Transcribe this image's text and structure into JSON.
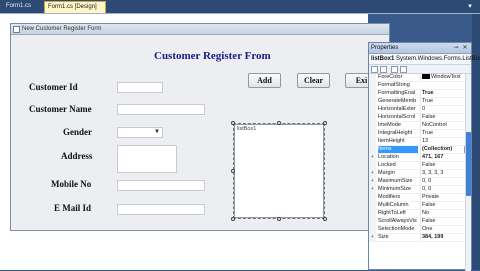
{
  "tabs": [
    {
      "label": "Form1.cs"
    },
    {
      "label": "Form1.cs [Design]"
    }
  ],
  "form": {
    "title": "New Customer Register Form",
    "heading": "Customer Register From",
    "labels": {
      "customer_id": "Customer Id",
      "customer_name": "Customer Name",
      "gender": "Gender",
      "address": "Address",
      "mobile_no": "Mobile No",
      "email_id": "E Mail Id"
    },
    "buttons": {
      "add": "Add",
      "clear": "Clear",
      "exit": "Exi"
    },
    "listbox_label": "listBox1"
  },
  "properties": {
    "title": "Properties",
    "object_name": "listBox1",
    "object_type": "System.Windows.Forms.ListBox",
    "rows": [
      {
        "gutter": "",
        "name": "ForeColor",
        "value": "WindowText",
        "swatch": true
      },
      {
        "gutter": "",
        "name": "FormatString",
        "value": ""
      },
      {
        "gutter": "",
        "name": "FormattingEnal",
        "value": "True",
        "bold": true
      },
      {
        "gutter": "",
        "name": "GenerateMemb",
        "value": "True"
      },
      {
        "gutter": "",
        "name": "HorizontalExter",
        "value": "0"
      },
      {
        "gutter": "",
        "name": "HorizontalScrol",
        "value": "False"
      },
      {
        "gutter": "",
        "name": "ImeMode",
        "value": "NoControl"
      },
      {
        "gutter": "",
        "name": "IntegralHeight",
        "value": "True"
      },
      {
        "gutter": "",
        "name": "ItemHeight",
        "value": "13"
      },
      {
        "gutter": "",
        "name": "Items",
        "value": "(Collection)",
        "selected": true,
        "ellipsis": true
      },
      {
        "gutter": "+",
        "name": "Location",
        "value": "471, 167",
        "bold": true
      },
      {
        "gutter": "",
        "name": "Locked",
        "value": "False"
      },
      {
        "gutter": "+",
        "name": "Margin",
        "value": "3, 3, 3, 3"
      },
      {
        "gutter": "+",
        "name": "MaximumSize",
        "value": "0, 0"
      },
      {
        "gutter": "+",
        "name": "MinimumSize",
        "value": "0, 0"
      },
      {
        "gutter": "",
        "name": "Modifiers",
        "value": "Private"
      },
      {
        "gutter": "",
        "name": "MultiColumn",
        "value": "False"
      },
      {
        "gutter": "",
        "name": "RightToLeft",
        "value": "No"
      },
      {
        "gutter": "",
        "name": "ScrollAlwaysVis",
        "value": "False"
      },
      {
        "gutter": "",
        "name": "SelectionMode",
        "value": "One"
      },
      {
        "gutter": "+",
        "name": "Size",
        "value": "384, 199",
        "bold": true
      }
    ]
  },
  "colors": {
    "accent": "#3399ff",
    "heading": "#1a1a8a",
    "ide_background": "#3a5a8c"
  }
}
